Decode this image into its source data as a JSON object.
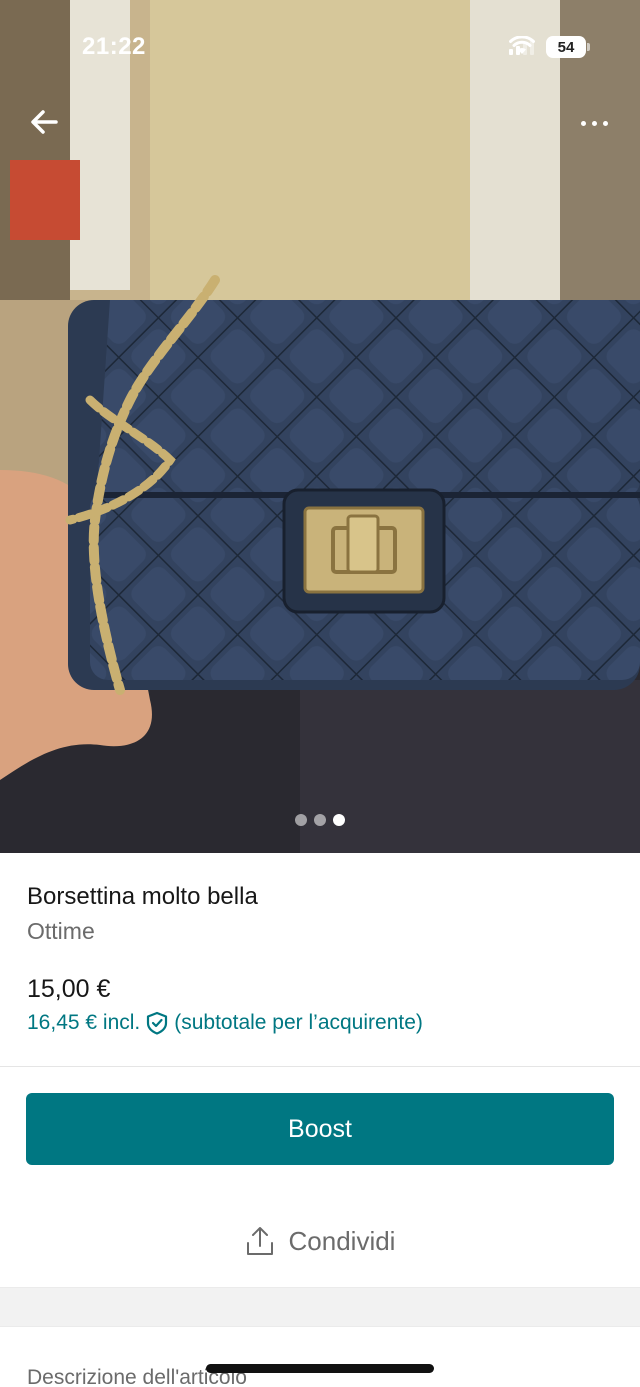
{
  "status_bar": {
    "time": "21:22",
    "battery": "54"
  },
  "photo": {
    "icons": {
      "back": "back-arrow-icon",
      "more": "more-horizontal-icon"
    },
    "carousel": {
      "count": 3,
      "active_index": 2
    }
  },
  "item": {
    "title": "Borsettina molto bella",
    "condition": "Ottime",
    "price": "15,00 €",
    "price_incl_prefix": "16,45 € incl.",
    "price_incl_suffix": "(subtotale per l’acquirente)"
  },
  "actions": {
    "boost_label": "Boost",
    "share_label": "Condividi"
  },
  "description": {
    "label": "Descrizione dell'articolo"
  },
  "colors": {
    "accent": "#007782",
    "text_primary": "#171717",
    "text_secondary": "#6b6b6b"
  }
}
